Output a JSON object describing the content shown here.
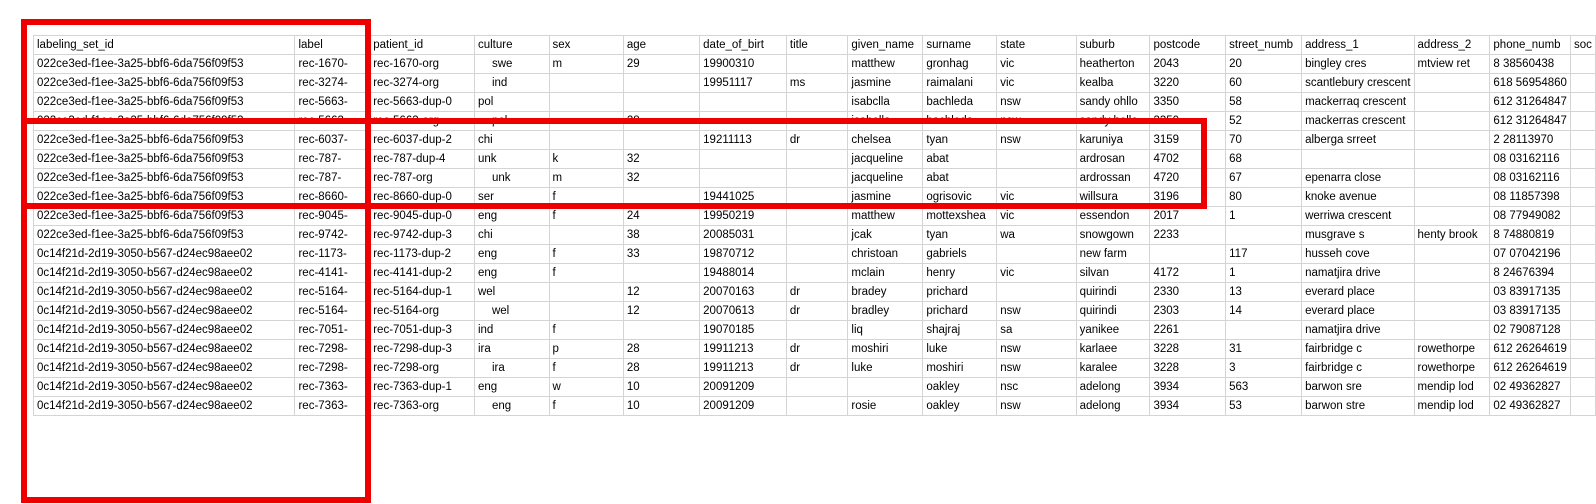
{
  "spreadsheet": {
    "headers": [
      "labeling_set_id",
      "label",
      "patient_id",
      "culture",
      "sex",
      "age",
      "date_of_birt",
      "title",
      "given_name",
      "surname",
      "state",
      "suburb",
      "postcode",
      "street_numb",
      "address_1",
      "address_2",
      "phone_numb",
      "soc"
    ],
    "rows": [
      [
        "022ce3ed-f1ee-3a25-bbf6-6da756f09f53",
        "rec-1670-",
        "rec-1670-org",
        "swe",
        "m",
        "29",
        "19900310",
        "",
        "matthew",
        "gronhag",
        "vic",
        "heatherton",
        "2043",
        "20",
        "bingley cres",
        "mtview ret",
        "8 38560438",
        ""
      ],
      [
        "022ce3ed-f1ee-3a25-bbf6-6da756f09f53",
        "rec-3274-",
        "rec-3274-org",
        "ind",
        "",
        "",
        "19951117",
        "ms",
        "jasmine",
        "raimalani",
        "vic",
        "kealba",
        "3220",
        "60",
        "scantlebury crescent",
        "",
        "618 56954860",
        ""
      ],
      [
        "022ce3ed-f1ee-3a25-bbf6-6da756f09f53",
        "rec-5663-",
        "rec-5663-dup-0",
        "pol",
        "",
        "",
        "",
        "",
        "isabclla",
        "bachleda",
        "nsw",
        "sandy ohllo",
        "3350",
        "58",
        "mackerraq crescent",
        "",
        "612 31264847",
        ""
      ],
      [
        "022ce3ed-f1ee-3a25-bbf6-6da756f09f53",
        "rec-5663-",
        "rec-5663-org",
        "pol",
        "",
        "28",
        "",
        "",
        "isabella",
        "bachleda",
        "nsw",
        "sandy hollo",
        "3350",
        "52",
        "mackerras crescent",
        "",
        "612 31264847",
        ""
      ],
      [
        "022ce3ed-f1ee-3a25-bbf6-6da756f09f53",
        "rec-6037-",
        "rec-6037-dup-2",
        "chi",
        "",
        "",
        "19211113",
        "dr",
        "chelsea",
        "tyan",
        "nsw",
        "karuniya",
        "3159",
        "70",
        "alberga srreet",
        "",
        "2 28113970",
        ""
      ],
      [
        "022ce3ed-f1ee-3a25-bbf6-6da756f09f53",
        "rec-787-",
        "rec-787-dup-4",
        "unk",
        "k",
        "32",
        "",
        "",
        "jacqueline",
        "abat",
        "",
        "ardrosan",
        "4702",
        "68",
        "",
        "",
        "08 03162116",
        ""
      ],
      [
        "022ce3ed-f1ee-3a25-bbf6-6da756f09f53",
        "rec-787-",
        "rec-787-org",
        "unk",
        "m",
        "32",
        "",
        "",
        "jacqueline",
        "abat",
        "",
        "ardrossan",
        "4720",
        "67",
        "epenarra close",
        "",
        "08 03162116",
        ""
      ],
      [
        "022ce3ed-f1ee-3a25-bbf6-6da756f09f53",
        "rec-8660-",
        "rec-8660-dup-0",
        "ser",
        "f",
        "",
        "19441025",
        "",
        "jasmine",
        "ogrisovic",
        "vic",
        "willsura",
        "3196",
        "80",
        "knoke avenue",
        "",
        "08 11857398",
        ""
      ],
      [
        "022ce3ed-f1ee-3a25-bbf6-6da756f09f53",
        "rec-9045-",
        "rec-9045-dup-0",
        "eng",
        "f",
        "24",
        "19950219",
        "",
        "matthew",
        "mottexshea",
        "vic",
        "essendon",
        "2017",
        "1",
        "werriwa crescent",
        "",
        "08 77949082",
        ""
      ],
      [
        "022ce3ed-f1ee-3a25-bbf6-6da756f09f53",
        "rec-9742-",
        "rec-9742-dup-3",
        "chi",
        "",
        "38",
        "20085031",
        "",
        "jcak",
        "tyan",
        "wa",
        "snowgown",
        "2233",
        "",
        "musgrave s",
        "henty brook",
        "8 74880819",
        ""
      ],
      [
        "0c14f21d-2d19-3050-b567-d24ec98aee02",
        "rec-1173-",
        "rec-1173-dup-2",
        "eng",
        "f",
        "33",
        "19870712",
        "",
        "christoan",
        "gabriels",
        "",
        "new farm",
        "",
        "117",
        "husseh cove",
        "",
        "07 07042196",
        ""
      ],
      [
        "0c14f21d-2d19-3050-b567-d24ec98aee02",
        "rec-4141-",
        "rec-4141-dup-2",
        "eng",
        "f",
        "",
        "19488014",
        "",
        "mclain",
        "henry",
        "vic",
        "silvan",
        "4172",
        "1",
        "namatjira drive",
        "",
        "8 24676394",
        ""
      ],
      [
        "0c14f21d-2d19-3050-b567-d24ec98aee02",
        "rec-5164-",
        "rec-5164-dup-1",
        "wel",
        "",
        "12",
        "20070163",
        "dr",
        "bradey",
        "prichard",
        "",
        "quirindi",
        "2330",
        "13",
        "everard place",
        "",
        "03 83917135",
        ""
      ],
      [
        "0c14f21d-2d19-3050-b567-d24ec98aee02",
        "rec-5164-",
        "rec-5164-org",
        "wel",
        "",
        "12",
        "20070613",
        "dr",
        "bradley",
        "prichard",
        "nsw",
        "quirindi",
        "2303",
        "14",
        "everard place",
        "",
        "03 83917135",
        ""
      ],
      [
        "0c14f21d-2d19-3050-b567-d24ec98aee02",
        "rec-7051-",
        "rec-7051-dup-3",
        "ind",
        "f",
        "",
        "19070185",
        "",
        "liq",
        "shajraj",
        "sa",
        "yanikee",
        "2261",
        "",
        "namatjira drive",
        "",
        "02 79087128",
        ""
      ],
      [
        "0c14f21d-2d19-3050-b567-d24ec98aee02",
        "rec-7298-",
        "rec-7298-dup-3",
        "ira",
        "p",
        "28",
        "19911213",
        "dr",
        "moshiri",
        "luke",
        "nsw",
        "karlaee",
        "3228",
        "31",
        "fairbridge c",
        "rowethorpe",
        "612 26264619",
        ""
      ],
      [
        "0c14f21d-2d19-3050-b567-d24ec98aee02",
        "rec-7298-",
        "rec-7298-org",
        "ira",
        "f",
        "28",
        "19911213",
        "dr",
        "luke",
        "moshiri",
        "nsw",
        "karalee",
        "3228",
        "3",
        "fairbridge c",
        "rowethorpe",
        "612 26264619",
        ""
      ],
      [
        "0c14f21d-2d19-3050-b567-d24ec98aee02",
        "rec-7363-",
        "rec-7363-dup-1",
        "eng",
        "w",
        "10",
        "20091209",
        "",
        "",
        "oakley",
        "nsc",
        "adelong",
        "3934",
        "563",
        "barwon sre",
        "mendip lod",
        "02 49362827",
        ""
      ],
      [
        "0c14f21d-2d19-3050-b567-d24ec98aee02",
        "rec-7363-",
        "rec-7363-org",
        "eng",
        "f",
        "10",
        "20091209",
        "",
        "rosie",
        "oakley",
        "nsw",
        "adelong",
        "3934",
        "53",
        "barwon stre",
        "mendip lod",
        "02 49362827",
        ""
      ]
    ]
  },
  "highlight": {
    "color": "#ee0000"
  }
}
